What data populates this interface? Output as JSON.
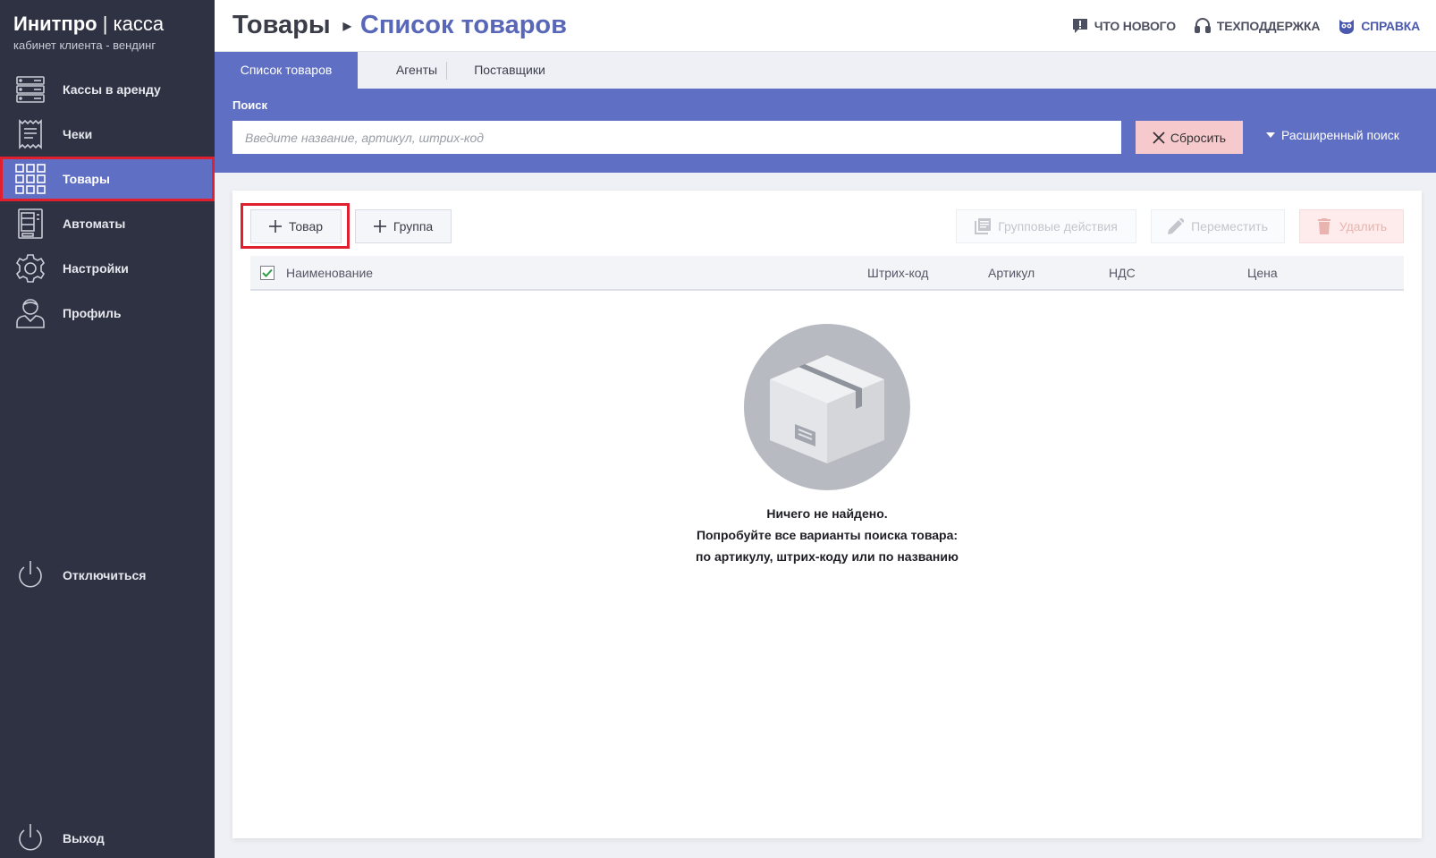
{
  "app": {
    "brand_bold": "Инитпро",
    "brand_sep": " | ",
    "brand_thin": "касса",
    "subtitle": "кабинет клиента - вендинг"
  },
  "sidebar": {
    "items": [
      {
        "label": "Кассы в аренду",
        "icon": "cash-register-icon"
      },
      {
        "label": "Чеки",
        "icon": "receipt-icon"
      },
      {
        "label": "Товары",
        "icon": "grid-icon",
        "active": true
      },
      {
        "label": "Автоматы",
        "icon": "vending-machine-icon"
      },
      {
        "label": "Настройки",
        "icon": "gear-icon"
      },
      {
        "label": "Профиль",
        "icon": "user-icon"
      }
    ],
    "disconnect_label": "Отключиться",
    "logout_label": "Выход"
  },
  "header": {
    "breadcrumb_root": "Товары",
    "breadcrumb_current": "Список товаров",
    "links": {
      "whats_new": "ЧТО НОВОГО",
      "support": "ТЕХПОДДЕРЖКА",
      "help": "СПРАВКА"
    }
  },
  "tabs": [
    {
      "label": "Список товаров",
      "active": true
    },
    {
      "label": "Агенты"
    },
    {
      "label": "Поставщики"
    }
  ],
  "search": {
    "label": "Поиск",
    "placeholder": "Введите название, артикул, штрих-код",
    "value": "",
    "reset_label": "Сбросить",
    "advanced_label": "Расширенный поиск"
  },
  "toolbar": {
    "add_product": "Товар",
    "add_group": "Группа",
    "group_actions": "Групповые действия",
    "move": "Переместить",
    "delete": "Удалить"
  },
  "table": {
    "columns": [
      "Наименование",
      "Штрих-код",
      "Артикул",
      "НДС",
      "Цена"
    ],
    "header_checked": true
  },
  "empty": {
    "line1": "Ничего не найдено.",
    "line2": "Попробуйте все варианты поиска товара:",
    "line3": "по артикулу, штрих-коду или по названию"
  },
  "colors": {
    "sidebar_bg": "#2e3242",
    "accent": "#5f6fc3",
    "breadcrumb_accent": "#5867b8",
    "highlight": "#e0202f",
    "reset_bg": "#f6c9cd"
  }
}
